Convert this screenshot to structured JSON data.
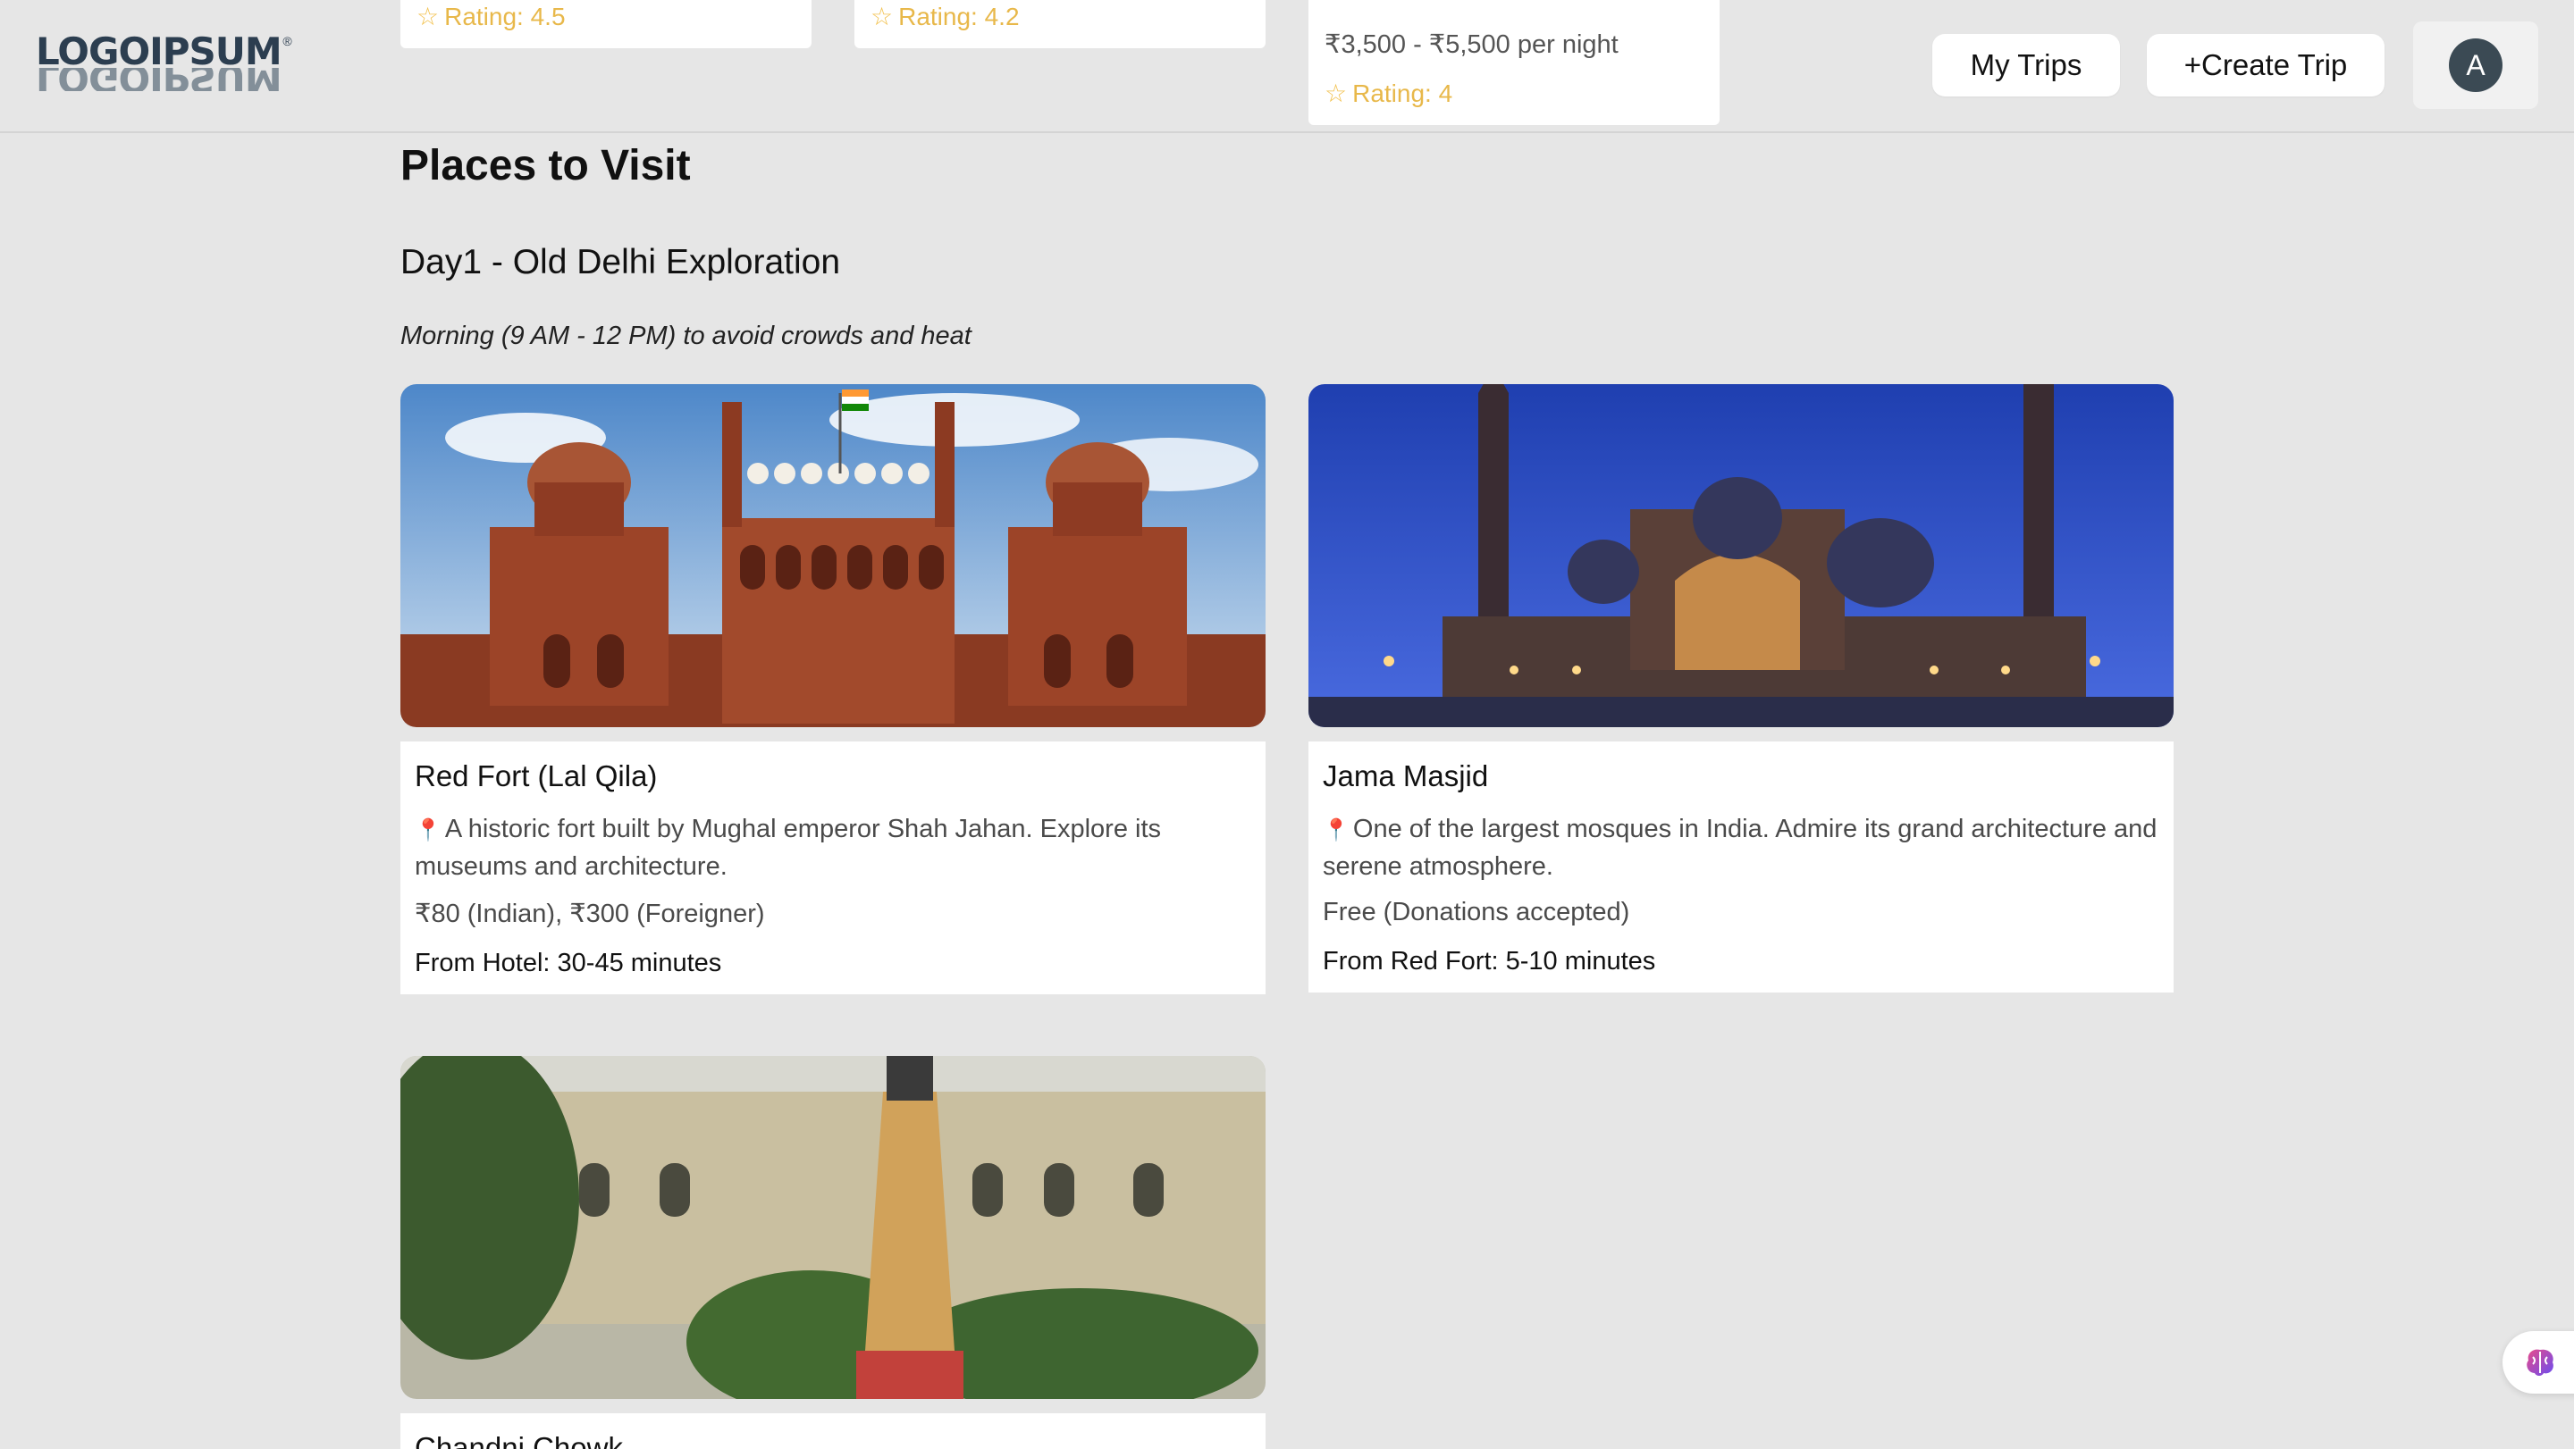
{
  "header": {
    "logo_text": "LOGOIPSUM",
    "nav": {
      "my_trips": "My Trips",
      "create_trip": "+Create Trip"
    },
    "avatar_initial": "A"
  },
  "hotels": [
    {
      "rating": "Rating: 4.5"
    },
    {
      "rating": "Rating: 4.2"
    },
    {
      "price": "₹3,500 - ₹5,500 per night",
      "rating": "Rating: 4"
    }
  ],
  "places_section": {
    "title": "Places to Visit",
    "day": {
      "title": "Day1 - Old Delhi Exploration",
      "time": "Morning (9 AM - 12 PM) to avoid crowds and heat",
      "places": [
        {
          "name": "Red Fort (Lal Qila)",
          "description": "A historic fort built by Mughal emperor Shah Jahan. Explore its museums and architecture.",
          "price": "₹80 (Indian), ₹300 (Foreigner)",
          "travel": "From Hotel: 30-45 minutes"
        },
        {
          "name": "Jama Masjid",
          "description": "One of the largest mosques in India. Admire its grand architecture and serene atmosphere.",
          "price": "Free (Donations accepted)",
          "travel": "From Red Fort: 5-10 minutes"
        },
        {
          "name": "Chandni Chowk"
        }
      ]
    }
  },
  "icons": {
    "star": "star-icon",
    "pin": "map-pin-icon",
    "assistant": "brain-icon"
  },
  "colors": {
    "page_bg": "#e6e6e6",
    "rating": "#e8b84a",
    "avatar_bg": "#3b4a54"
  }
}
